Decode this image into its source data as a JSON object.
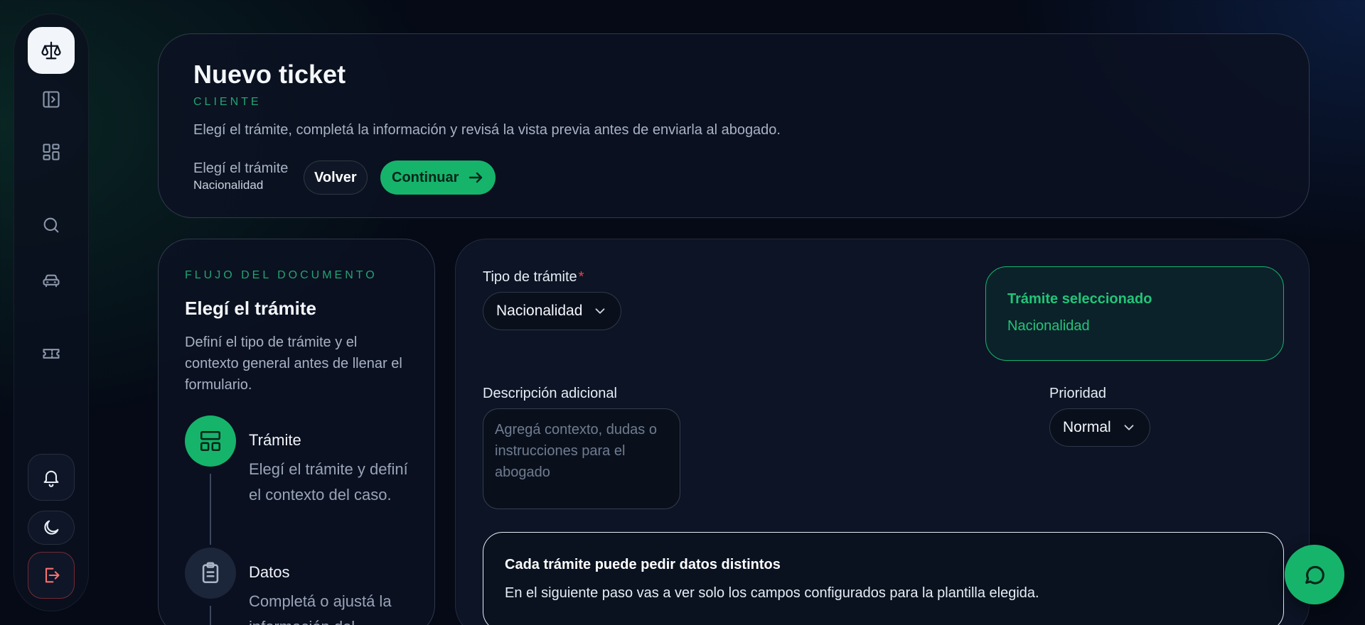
{
  "sidebar": {
    "icons": [
      "scale-icon",
      "sidebar-toggle-icon",
      "dashboard-icon",
      "search-icon",
      "car-icon",
      "ticket-icon",
      "bell-icon",
      "moon-icon",
      "logout-icon"
    ]
  },
  "header": {
    "title": "Nuevo ticket",
    "eyebrow": "CLIENTE",
    "description": "Elegí el trámite, completá la información y revisá la vista previa antes de enviarla al abogado.",
    "step_label": "Elegí el trámite",
    "step_value": "Nacionalidad",
    "back_label": "Volver",
    "continue_label": "Continuar"
  },
  "flow": {
    "eyebrow": "FLUJO DEL DOCUMENTO",
    "title": "Elegí el trámite",
    "description": "Definí el tipo de trámite y el contexto general antes de llenar el formulario.",
    "steps": [
      {
        "name": "Trámite",
        "description": "Elegí el trámite y definí el contexto del caso.",
        "icon": "layout-icon",
        "active": true
      },
      {
        "name": "Datos",
        "description": "Completá o ajustá la información del",
        "icon": "clipboard-icon",
        "active": false
      }
    ]
  },
  "form": {
    "tipo_label": "Tipo de trámite",
    "required_mark": "*",
    "tipo_value": "Nacionalidad",
    "selected_title": "Trámite seleccionado",
    "selected_value": "Nacionalidad",
    "descripcion_label": "Descripción adicional",
    "descripcion_placeholder": "Agregá contexto, dudas o instrucciones para el abogado",
    "prioridad_label": "Prioridad",
    "prioridad_value": "Normal",
    "info_title": "Cada trámite puede pedir datos distintos",
    "info_text": "En el siguiente paso vas a ver solo los campos configurados para la plantilla elegida."
  },
  "colors": {
    "accent": "#16b46b",
    "danger": "#ef4444",
    "background": "#050a16"
  }
}
